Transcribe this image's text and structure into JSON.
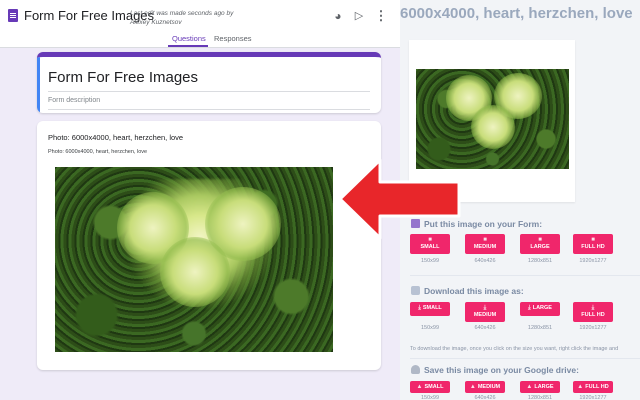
{
  "forms": {
    "title": "Form For Free Images",
    "last_edit": "Last edit was made seconds ago by Alexey Kuznetsov",
    "tabs": [
      "Questions",
      "Responses"
    ],
    "form_title": "Form For Free Images",
    "form_description_placeholder": "Form description",
    "question": {
      "title": "Photo: 6000x4000, heart, herzchen, love",
      "description": "Photo: 6000x4000, heart, herzchen, love"
    },
    "icons": [
      "palette-icon",
      "send-icon",
      "more-vert-icon"
    ]
  },
  "image_page": {
    "title": "6000x4000, heart, herzchen, love",
    "sections": {
      "put_on_form": {
        "title": "Put this image on your Form:",
        "buttons": [
          {
            "label": "SMALL",
            "size": "150x99"
          },
          {
            "label": "MEDIUM",
            "size": "640x426"
          },
          {
            "label": "LARGE",
            "size": "1280x851"
          },
          {
            "label": "FULL HD",
            "size": "1920x1277"
          }
        ]
      },
      "download": {
        "title": "Download this image as:",
        "buttons": [
          {
            "label": "SMALL",
            "size": "150x99"
          },
          {
            "label": "MEDIUM",
            "size": "640x426"
          },
          {
            "label": "LARGE",
            "size": "1280x851"
          },
          {
            "label": "FULL HD",
            "size": "1920x1277"
          }
        ],
        "note": "To download the image, once you click on the size you want, right click the image and"
      },
      "drive": {
        "title": "Save this image on your Google drive:",
        "buttons": [
          {
            "label": "SMALL",
            "size": "150x99"
          },
          {
            "label": "MEDIUM",
            "size": "640x426"
          },
          {
            "label": "LARGE",
            "size": "1280x851"
          },
          {
            "label": "FULL HD",
            "size": "1920x1277"
          }
        ]
      }
    }
  },
  "colors": {
    "forms_accent": "#673ab7",
    "button_pink": "#f0266b",
    "arrow_red": "#e8262a"
  }
}
